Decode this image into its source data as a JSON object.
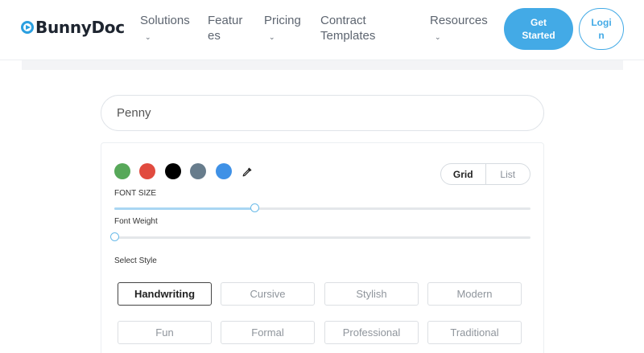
{
  "header": {
    "logo_text": "BunnyDoc",
    "nav": [
      {
        "label": "Solutions",
        "chevron": "⌄"
      },
      {
        "label": "Features",
        "chevron": ""
      },
      {
        "label": "Pricing",
        "chevron": "⌄"
      },
      {
        "label": "Contract Templates",
        "chevron": ""
      },
      {
        "label": "Resources",
        "chevron": "⌄"
      }
    ],
    "get_started_label": "Get Started",
    "login_label": "Login"
  },
  "signature": {
    "name_value": "Penny"
  },
  "colors": [
    {
      "name": "green",
      "hex": "#57a859"
    },
    {
      "name": "red",
      "hex": "#e14b3f"
    },
    {
      "name": "black",
      "hex": "#000000"
    },
    {
      "name": "slate",
      "hex": "#677c8c"
    },
    {
      "name": "blue",
      "hex": "#3f91e6"
    }
  ],
  "view_toggle": {
    "grid_label": "Grid",
    "list_label": "List",
    "selected": "Grid"
  },
  "font_size": {
    "label": "FONT SIZE",
    "value_fraction": 0.337
  },
  "font_weight": {
    "label": "Font Weight",
    "value_fraction": 0.0
  },
  "styles": {
    "label": "Select Style",
    "selected": "Handwriting",
    "options": [
      "Handwriting",
      "Cursive",
      "Stylish",
      "Modern",
      "Fun",
      "Formal",
      "Professional",
      "Traditional"
    ]
  },
  "accent_color": "#43aae6"
}
